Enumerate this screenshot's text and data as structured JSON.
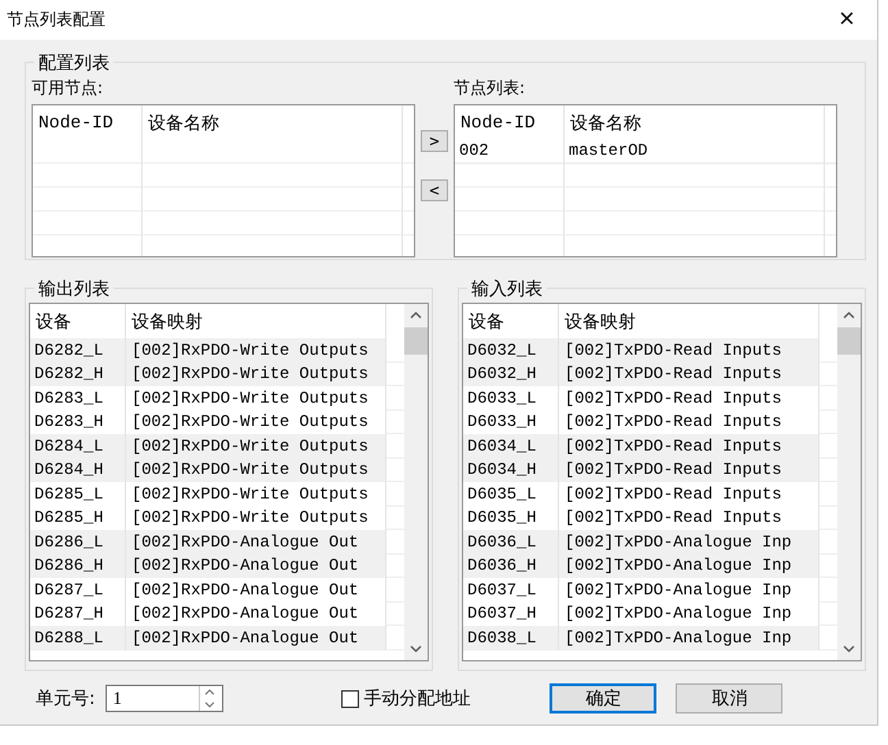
{
  "window": {
    "title": "节点列表配置",
    "close": "×"
  },
  "config_group": {
    "title": "配置列表",
    "available": {
      "label": "可用节点:",
      "columns": [
        "Node-ID",
        "设备名称"
      ]
    },
    "move_right": ">",
    "move_left": "<",
    "node_list": {
      "label": "节点列表:",
      "columns": [
        "Node-ID",
        "设备名称"
      ],
      "rows": [
        {
          "node_id": "002",
          "device_name": "masterOD"
        }
      ]
    }
  },
  "output_list": {
    "title": "输出列表",
    "columns": [
      "设备",
      "设备映射"
    ],
    "rows": [
      {
        "device": "D6282_L",
        "mapping": "[002]RxPDO-Write Outputs",
        "shaded": true
      },
      {
        "device": "D6282_H",
        "mapping": "[002]RxPDO-Write Outputs",
        "shaded": true
      },
      {
        "device": "D6283_L",
        "mapping": "[002]RxPDO-Write Outputs",
        "shaded": false
      },
      {
        "device": "D6283_H",
        "mapping": "[002]RxPDO-Write Outputs",
        "shaded": false
      },
      {
        "device": "D6284_L",
        "mapping": "[002]RxPDO-Write Outputs",
        "shaded": true
      },
      {
        "device": "D6284_H",
        "mapping": "[002]RxPDO-Write Outputs",
        "shaded": true
      },
      {
        "device": "D6285_L",
        "mapping": "[002]RxPDO-Write Outputs",
        "shaded": false
      },
      {
        "device": "D6285_H",
        "mapping": "[002]RxPDO-Write Outputs",
        "shaded": false
      },
      {
        "device": "D6286_L",
        "mapping": "[002]RxPDO-Analogue Out",
        "shaded": true
      },
      {
        "device": "D6286_H",
        "mapping": "[002]RxPDO-Analogue Out",
        "shaded": true
      },
      {
        "device": "D6287_L",
        "mapping": "[002]RxPDO-Analogue Out",
        "shaded": false
      },
      {
        "device": "D6287_H",
        "mapping": "[002]RxPDO-Analogue Out",
        "shaded": false
      },
      {
        "device": "D6288_L",
        "mapping": "[002]RxPDO-Analogue Out",
        "shaded": true
      }
    ]
  },
  "input_list": {
    "title": "输入列表",
    "columns": [
      "设备",
      "设备映射"
    ],
    "rows": [
      {
        "device": "D6032_L",
        "mapping": "[002]TxPDO-Read Inputs",
        "shaded": true
      },
      {
        "device": "D6032_H",
        "mapping": "[002]TxPDO-Read Inputs",
        "shaded": true
      },
      {
        "device": "D6033_L",
        "mapping": "[002]TxPDO-Read Inputs",
        "shaded": false
      },
      {
        "device": "D6033_H",
        "mapping": "[002]TxPDO-Read Inputs",
        "shaded": false
      },
      {
        "device": "D6034_L",
        "mapping": "[002]TxPDO-Read Inputs",
        "shaded": true
      },
      {
        "device": "D6034_H",
        "mapping": "[002]TxPDO-Read Inputs",
        "shaded": true
      },
      {
        "device": "D6035_L",
        "mapping": "[002]TxPDO-Read Inputs",
        "shaded": false
      },
      {
        "device": "D6035_H",
        "mapping": "[002]TxPDO-Read Inputs",
        "shaded": false
      },
      {
        "device": "D6036_L",
        "mapping": "[002]TxPDO-Analogue Inp",
        "shaded": true
      },
      {
        "device": "D6036_H",
        "mapping": "[002]TxPDO-Analogue Inp",
        "shaded": true
      },
      {
        "device": "D6037_L",
        "mapping": "[002]TxPDO-Analogue Inp",
        "shaded": false
      },
      {
        "device": "D6037_H",
        "mapping": "[002]TxPDO-Analogue Inp",
        "shaded": false
      },
      {
        "device": "D6038_L",
        "mapping": "[002]TxPDO-Analogue Inp",
        "shaded": true
      }
    ]
  },
  "unit": {
    "label": "单元号:",
    "value": "1"
  },
  "manual_address": {
    "label": "手动分配地址",
    "checked": false
  },
  "buttons": [
    {
      "label": "确定",
      "default": true
    },
    {
      "label": "取消",
      "default": false
    }
  ]
}
